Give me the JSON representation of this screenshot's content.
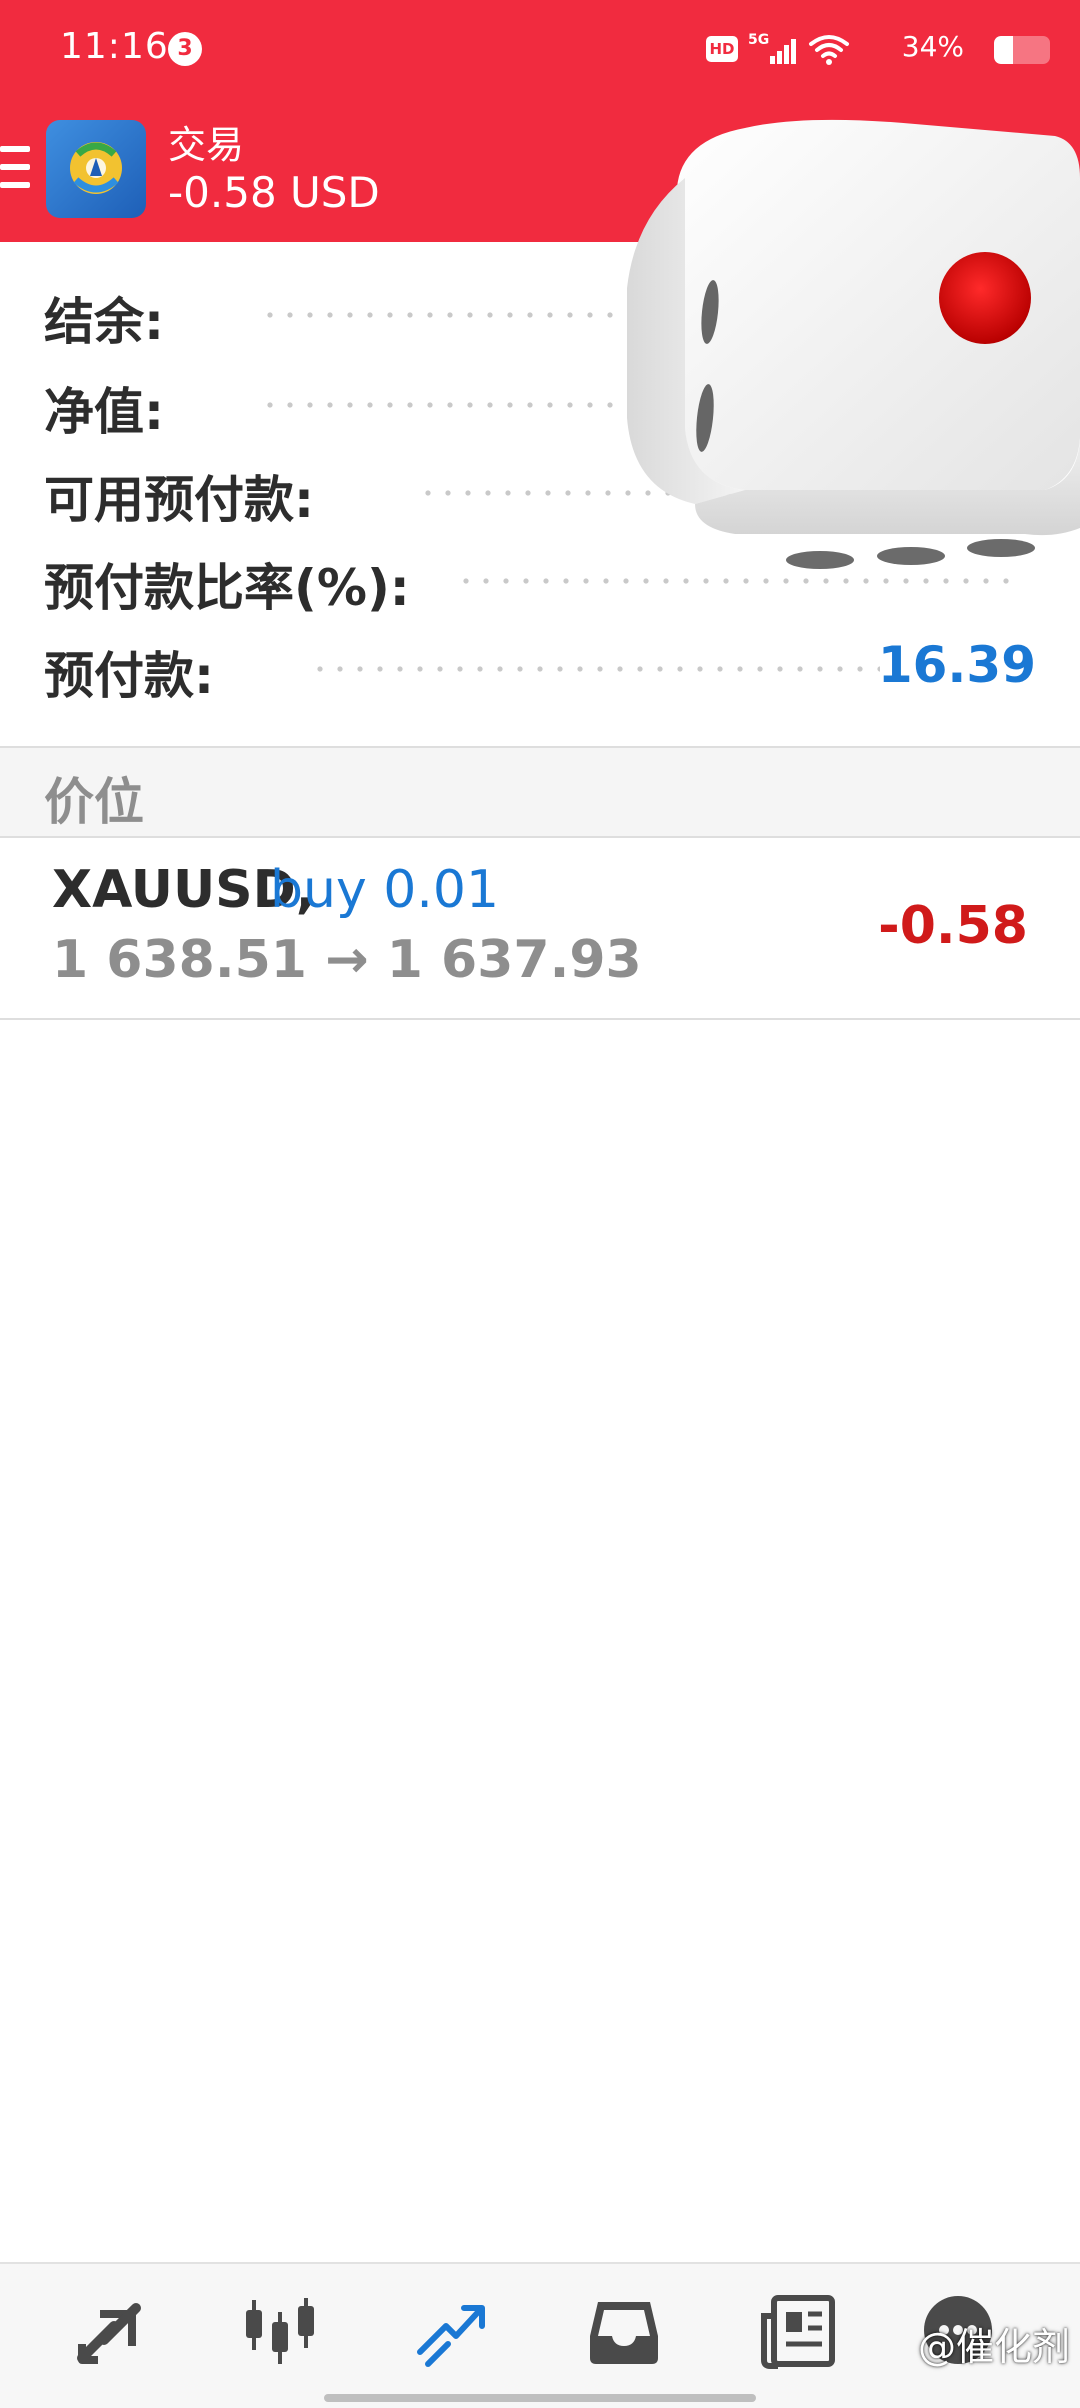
{
  "status_bar": {
    "time": "11:16",
    "notification_count": "3",
    "hd_label": "HD",
    "network_label": "5G",
    "battery_percent": "34%",
    "battery_level": 0.34
  },
  "toolbar": {
    "title": "交易",
    "subtitle": "-0.58 USD",
    "accent_color": "#f12b3f"
  },
  "account_summary": {
    "rows": [
      {
        "label": "结余:",
        "value": ""
      },
      {
        "label": "净值:",
        "value": ""
      },
      {
        "label": "可用预付款:",
        "value": ""
      },
      {
        "label": "预付款比率(%):",
        "value": ""
      },
      {
        "label": "预付款:",
        "value": "16.39"
      }
    ]
  },
  "positions": {
    "section_title": "价位",
    "items": [
      {
        "symbol": "XAUUSD,",
        "side": "buy 0.01",
        "open_price": "1 638.51",
        "arrow": "→",
        "current_price": "1 637.93",
        "profit": "-0.58"
      }
    ]
  },
  "bottom_nav": {
    "items": [
      {
        "icon": "quotes-icon",
        "active": false
      },
      {
        "icon": "chart-icon",
        "active": false
      },
      {
        "icon": "trade-icon",
        "active": true
      },
      {
        "icon": "history-icon",
        "active": false
      },
      {
        "icon": "news-icon",
        "active": false
      },
      {
        "icon": "messages-icon",
        "active": false
      }
    ],
    "active_color": "#1a78d4",
    "inactive_color": "#4a4a4a"
  },
  "watermark": "@催化剂"
}
